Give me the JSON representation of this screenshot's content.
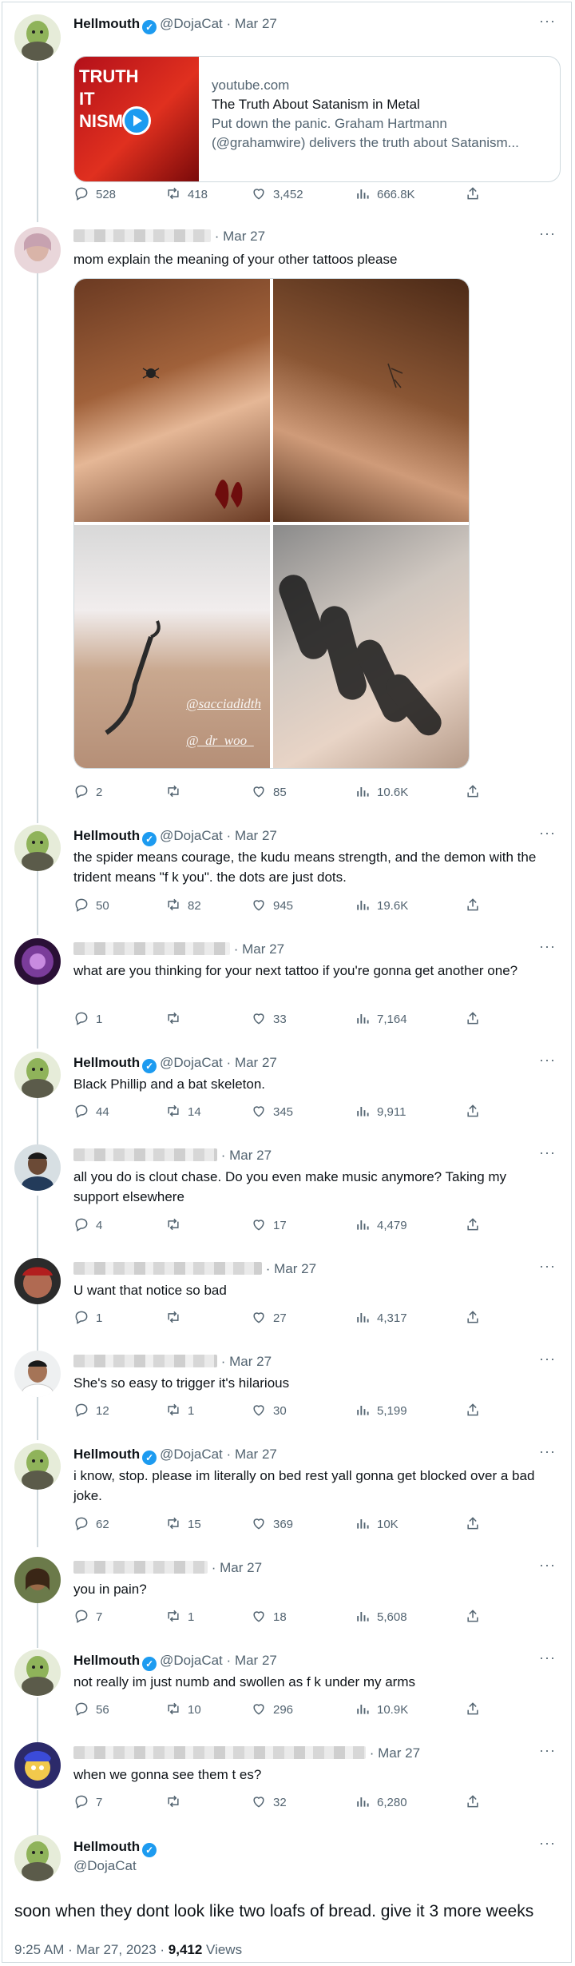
{
  "tweets": [
    {
      "name": "Hellmouth",
      "verified": true,
      "handle": "@DojaCat",
      "dot": "·",
      "date": "Mar 27",
      "more": "···",
      "card": {
        "domain": "youtube.com",
        "title": "The Truth About Satanism in Metal",
        "desc1": "Put down the panic. Graham Hartmann",
        "desc2": "(@grahamwire) delivers the truth about Satanism...",
        "thumb_text1": "TRUTH",
        "thumb_text2": "IT",
        "thumb_text3": "NISM"
      },
      "reply": "528",
      "retweet": "418",
      "like": "3,452",
      "views": "666.8K"
    },
    {
      "name": "",
      "handle": "",
      "dot": "·",
      "date": "Mar 27",
      "more": "···",
      "text": "mom explain the meaning of your other tattoos please",
      "watermark1": "@sacciadidth",
      "watermark2": "@_dr_woo_",
      "reply": "2",
      "retweet": "",
      "like": "85",
      "views": "10.6K"
    },
    {
      "name": "Hellmouth",
      "verified": true,
      "handle": "@DojaCat",
      "dot": "·",
      "date": "Mar 27",
      "more": "···",
      "text": "the spider means courage, the kudu means strength, and the demon with the trident means \"f    k you\". the dots are just dots.",
      "reply": "50",
      "retweet": "82",
      "like": "945",
      "views": "19.6K"
    },
    {
      "name": "",
      "handle": "",
      "dot": "·",
      "date": "Mar 27",
      "more": "···",
      "text": "what are you thinking for your next tattoo if you're gonna get another one?",
      "reply": "1",
      "retweet": "",
      "like": "33",
      "views": "7,164"
    },
    {
      "name": "Hellmouth",
      "verified": true,
      "handle": "@DojaCat",
      "dot": "·",
      "date": "Mar 27",
      "more": "···",
      "text": "Black Phillip and a bat skeleton.",
      "reply": "44",
      "retweet": "14",
      "like": "345",
      "views": "9,911"
    },
    {
      "name": "",
      "handle": "",
      "dot": "·",
      "date": "Mar 27",
      "more": "···",
      "text": "all you do is clout chase. Do you even make music anymore? Taking my support elsewhere",
      "reply": "4",
      "retweet": "",
      "like": "17",
      "views": "4,479"
    },
    {
      "name": "",
      "handle": "",
      "dot": "·",
      "date": "Mar 27",
      "more": "···",
      "text": "U want that notice so bad",
      "reply": "1",
      "retweet": "",
      "like": "27",
      "views": "4,317"
    },
    {
      "name": "",
      "handle": "",
      "dot": "·",
      "date": "Mar 27",
      "more": "···",
      "text": "She's so easy to trigger it's hilarious",
      "reply": "12",
      "retweet": "1",
      "like": "30",
      "views": "5,199"
    },
    {
      "name": "Hellmouth",
      "verified": true,
      "handle": "@DojaCat",
      "dot": "·",
      "date": "Mar 27",
      "more": "···",
      "text": "i know, stop. please im literally on bed rest yall gonna get blocked over a bad joke.",
      "reply": "62",
      "retweet": "15",
      "like": "369",
      "views": "10K"
    },
    {
      "name": "",
      "handle": "",
      "dot": "·",
      "date": "Mar 27",
      "more": "···",
      "text": "you in pain?",
      "reply": "7",
      "retweet": "1",
      "like": "18",
      "views": "5,608"
    },
    {
      "name": "Hellmouth",
      "verified": true,
      "handle": "@DojaCat",
      "dot": "·",
      "date": "Mar 27",
      "more": "···",
      "text": "not really im just numb and swollen as f    k under my arms",
      "reply": "56",
      "retweet": "10",
      "like": "296",
      "views": "10.9K"
    },
    {
      "name": "",
      "handle": "",
      "dot": "·",
      "date": "Mar 27",
      "more": "···",
      "text": "when we gonna see them t    es?",
      "reply": "7",
      "retweet": "",
      "like": "32",
      "views": "6,280"
    }
  ],
  "main": {
    "name": "Hellmouth",
    "verified": true,
    "handle": "@DojaCat",
    "more": "···",
    "text": "soon when they dont look like two loafs of bread. give it 3 more weeks",
    "time": "9:25 AM · Mar 27, 2023 · ",
    "views_count": "9,412",
    "views_label": " Views"
  },
  "colors": {
    "accent": "#1d9bf0",
    "secondary_text": "#536471",
    "border": "#cfd9de"
  },
  "icons": [
    "reply-icon",
    "retweet-icon",
    "like-icon",
    "views-icon",
    "share-icon",
    "verified-icon",
    "more-icon",
    "play-icon"
  ]
}
